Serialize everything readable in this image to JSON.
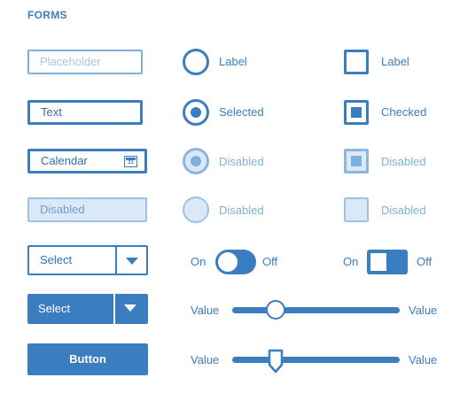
{
  "section_title": "FORMS",
  "inputs": {
    "placeholder": "Placeholder",
    "text": "Text",
    "calendar": "Calendar",
    "calendar_day": "31",
    "disabled": "Disabled"
  },
  "selects": {
    "outline_label": "Select",
    "filled_label": "Select"
  },
  "button": {
    "label": "Button"
  },
  "radios": [
    {
      "label": "Label",
      "state": "unchecked"
    },
    {
      "label": "Selected",
      "state": "checked"
    },
    {
      "label": "Disabled",
      "state": "checked-disabled"
    },
    {
      "label": "Disabled",
      "state": "disabled"
    }
  ],
  "checkboxes": [
    {
      "label": "Label",
      "state": "unchecked"
    },
    {
      "label": "Checked",
      "state": "checked"
    },
    {
      "label": "Disabled",
      "state": "checked-disabled"
    },
    {
      "label": "Disabled",
      "state": "disabled"
    }
  ],
  "toggles": [
    {
      "on_label": "On",
      "off_label": "Off",
      "state": "on",
      "style": "round"
    },
    {
      "on_label": "On",
      "off_label": "Off",
      "state": "on",
      "style": "square"
    }
  ],
  "sliders": [
    {
      "left_label": "Value",
      "right_label": "Value",
      "value": 0.26,
      "thumb": "round"
    },
    {
      "left_label": "Value",
      "right_label": "Value",
      "value": 0.26,
      "thumb": "pointer"
    }
  ],
  "colors": {
    "primary": "#3a7ec0",
    "disabled_fill": "#dbe9f6",
    "disabled_border": "#9cc2e6"
  }
}
